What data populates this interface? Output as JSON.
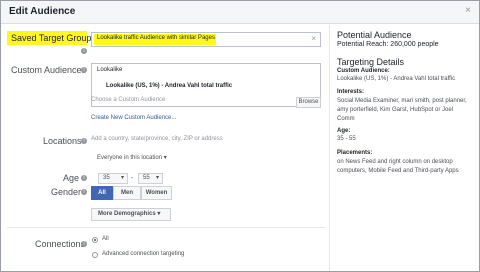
{
  "window": {
    "title": "Edit Audience",
    "close": "×"
  },
  "left": {
    "saved_target_group": {
      "label": "Saved Target Group",
      "value": "Lookalike traffic Audience with similar Pages",
      "clear": "×"
    },
    "custom_audiences": {
      "label": "Custom Audiences",
      "line1": "Lookalike",
      "line2": "Lookalike (US, 1%) - Andrea Vahl total traffic",
      "placeholder": "Choose a Custom Audience",
      "browse": "Browse",
      "create_link": "Create New Custom Audience..."
    },
    "locations": {
      "label": "Locations",
      "placeholder": "Add a country, state/province, city, ZIP or address",
      "select_value": "Everyone in this location"
    },
    "age": {
      "label": "Age",
      "min": "35",
      "max": "55",
      "separator": "-"
    },
    "gender": {
      "label": "Gender",
      "options": [
        "All",
        "Men",
        "Women"
      ],
      "selected": "All"
    },
    "more_demographics": "More Demographics",
    "connections": {
      "label": "Connections",
      "options": [
        "All",
        "Advanced connection targeting"
      ],
      "selected": "All"
    }
  },
  "right": {
    "potential_audience_title": "Potential Audience",
    "potential_reach": "Potential Reach: 260,000 people",
    "targeting_title": "Targeting Details",
    "custom_audience_heading": "Custom Audience:",
    "custom_audience_value": "Lookalike (US, 1%) - Andrea Vahl total traffic",
    "interests_heading": "Interests:",
    "interests_value": "Social Media Examiner, mari smith, post planner, amy porterfield, Kim Garst, HubSpot or Joel Comm",
    "age_heading": "Age:",
    "age_value": "35 - 55",
    "placements_heading": "Placements:",
    "placements_value": "on News Feed and right column on desktop computers, Mobile Feed and Third-party Apps"
  },
  "colors": {
    "highlight": "#fff71d",
    "accent": "#4267b2",
    "link": "#365899"
  }
}
